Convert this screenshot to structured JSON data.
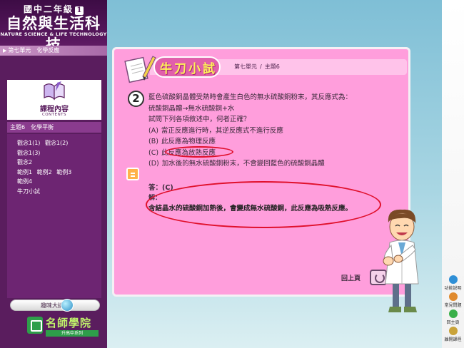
{
  "brand": {
    "grade_text": "國中二年級",
    "grade_num": "1",
    "title": "自然與生活科技",
    "subtitle": "NATURE SCIENCE & LIFE TECHNOLOGY"
  },
  "breadcrumb": {
    "unit": "第七單元",
    "topic": "化學反應"
  },
  "contents": {
    "title": "課程內容",
    "subtitle": "CONTENTS"
  },
  "topic_bar": "主題6　化學平衡",
  "topic_rows": [
    [
      "觀念1(1)",
      "觀念1(2)"
    ],
    [
      "觀念1(3)"
    ],
    [
      "觀念2"
    ],
    [
      "範例1",
      "範例2",
      "範例3"
    ],
    [
      "範例4"
    ],
    [
      "牛刀小試"
    ]
  ],
  "challenge_label": "趣味大挑戰",
  "mingshi": {
    "name": "名師學院",
    "series": "升高中系列"
  },
  "card": {
    "title": "牛刀小試",
    "unit": "第七單元",
    "sep": "/",
    "topic": "主題6",
    "question_number": "2",
    "question_lines": [
      "藍色硫酸銅晶體受熱時會產生白色的無水硫酸銅粉末，其反應式為：",
      "硫酸銅晶體→無水硫酸銅+水",
      "試問下列各項敘述中，何者正確？"
    ],
    "options": [
      {
        "letter": "(A)",
        "text": "當正反應進行時，其逆反應式不進行反應"
      },
      {
        "letter": "(B)",
        "text": "此反應為物理反應"
      },
      {
        "letter": "(C)",
        "text": "此反應為放熱反應"
      },
      {
        "letter": "(D)",
        "text": "加水後的無水硫酸銅粉末，不會變回藍色的硫酸銅晶體"
      }
    ],
    "answer": "答：(C)",
    "explain_label": "解：",
    "explanation": "含結晶水的硫酸銅加熱後，會變成無水硫酸銅，此反應為吸熱反應。",
    "back_label": "回上頁"
  },
  "toolbar": [
    {
      "label": "功能說明",
      "color": "#2f8fd6"
    },
    {
      "label": "常見問題",
      "color": "#e08a2e"
    },
    {
      "label": "回主頁",
      "color": "#3ab04a"
    },
    {
      "label": "離開課程",
      "color": "#c9a33a"
    }
  ]
}
